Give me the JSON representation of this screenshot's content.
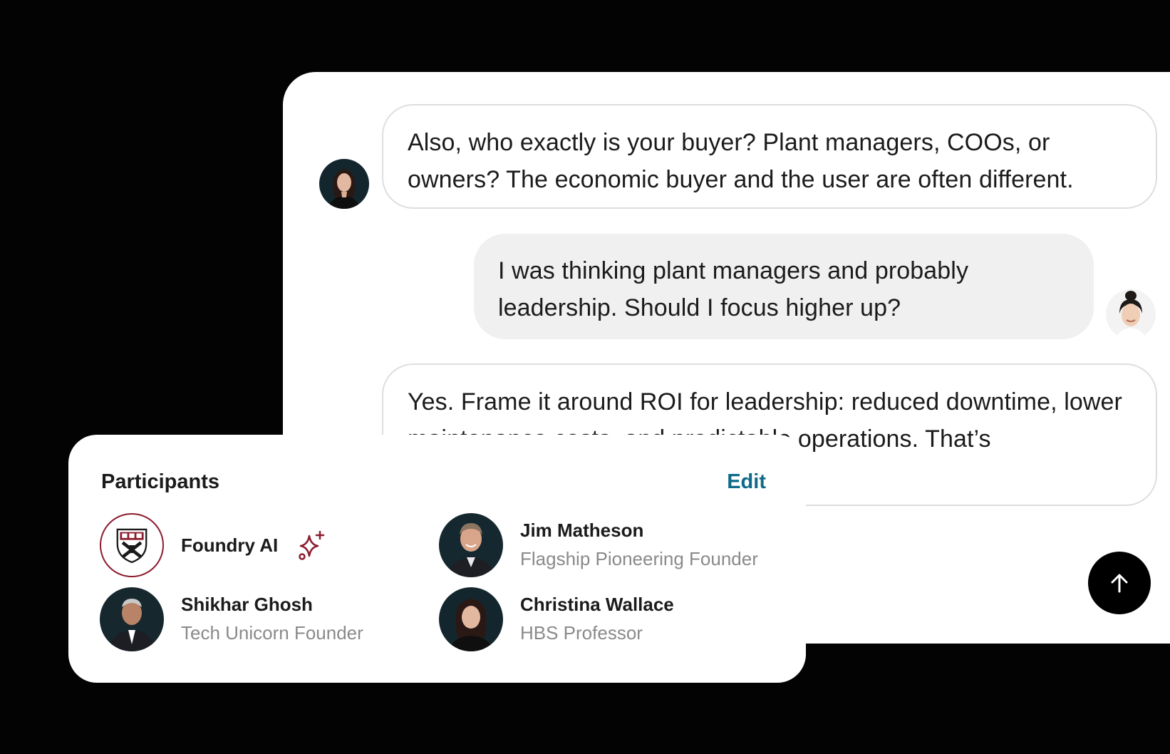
{
  "chat": {
    "messages": [
      {
        "sender": "advisor",
        "text": "Also, who exactly is your buyer? Plant managers, COOs, or owners? The economic buyer and the user are often different."
      },
      {
        "sender": "user",
        "text": "I was thinking plant managers and probably leadership. Should I focus higher up?"
      },
      {
        "sender": "advisor",
        "text": "Yes. Frame it around ROI for leadership: reduced downtime, lower maintenance costs, and predictable operations. That’s"
      }
    ],
    "send_icon": "arrow-up-icon"
  },
  "participants": {
    "title": "Participants",
    "edit_label": "Edit",
    "items": [
      {
        "name": "Foundry AI",
        "role": "",
        "icon": "sparkle-icon",
        "logo": "shield-crest-logo"
      },
      {
        "name": "Jim Matheson",
        "role": "Flagship Pioneering Founder"
      },
      {
        "name": "Shikhar Ghosh",
        "role": "Tech Unicorn Founder"
      },
      {
        "name": "Christina Wallace",
        "role": "HBS Professor"
      }
    ]
  },
  "colors": {
    "background": "#030303",
    "accent_link": "#0f6a8a",
    "brand_crimson": "#8c1b2e",
    "user_bubble": "#f0f0f0",
    "advisor_bubble_border": "#dedede"
  }
}
